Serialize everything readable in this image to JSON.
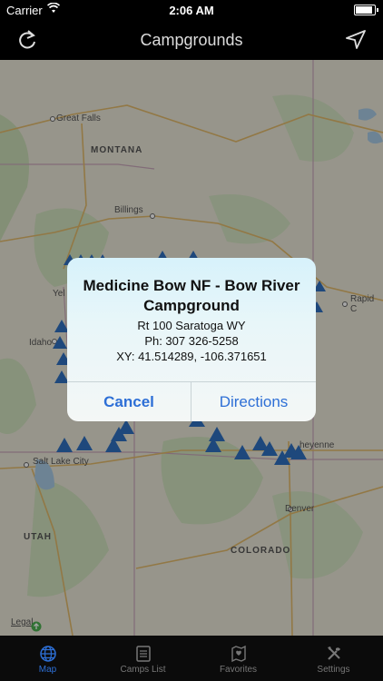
{
  "status": {
    "carrier": "Carrier",
    "time": "2:06 AM"
  },
  "nav": {
    "title": "Campgrounds"
  },
  "map": {
    "cities": [
      "Great Falls",
      "Billings",
      "Salt Lake City",
      "Denver",
      "Rapid C",
      "Idaho",
      "Yel",
      "heyenne"
    ],
    "states": [
      "MONTANA",
      "UTAH",
      "COLORADO"
    ],
    "legal": "Legal"
  },
  "alert": {
    "title": "Medicine Bow NF - Bow River Campground",
    "address": "Rt 100 Saratoga WY",
    "phone": "Ph: 307 326-5258",
    "coords": "XY: 41.514289, -106.371651",
    "cancel": "Cancel",
    "directions": "Directions"
  },
  "tabs": [
    {
      "label": "Map",
      "icon": "globe-icon",
      "active": true
    },
    {
      "label": "Camps List",
      "icon": "list-icon",
      "active": false
    },
    {
      "label": "Favorites",
      "icon": "favorites-icon",
      "active": false
    },
    {
      "label": "Settings",
      "icon": "settings-icon",
      "active": false
    }
  ],
  "colors": {
    "accent": "#2d6fd6",
    "marker": "#2f6fbf"
  }
}
